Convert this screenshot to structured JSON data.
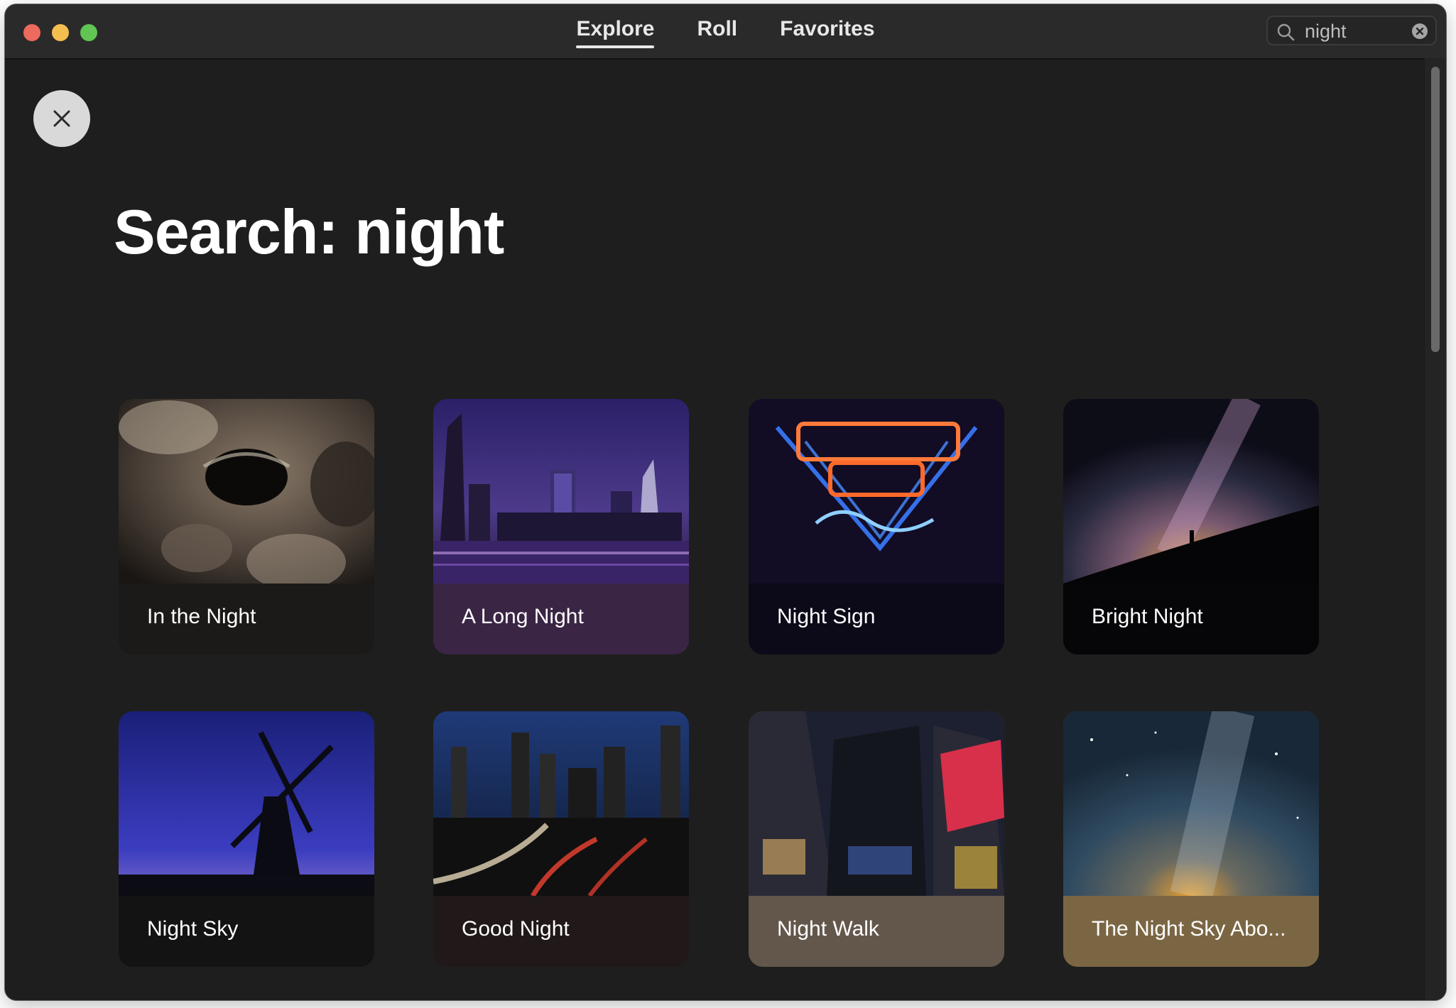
{
  "titlebar": {
    "tabs": [
      {
        "label": "Explore",
        "active": true
      },
      {
        "label": "Roll",
        "active": false
      },
      {
        "label": "Favorites",
        "active": false
      }
    ],
    "search": {
      "value": "night",
      "icon": "search-icon",
      "clear_icon": "clear-circle-icon"
    }
  },
  "main": {
    "close_icon": "close-icon",
    "title": "Search: night"
  },
  "cards": [
    {
      "title": "In the Night",
      "label_bg": "#1c1a18"
    },
    {
      "title": "A Long Night",
      "label_bg": "#3a2544"
    },
    {
      "title": "Night Sign",
      "label_bg": "#0c0a18"
    },
    {
      "title": "Bright Night",
      "label_bg": "#060608"
    },
    {
      "title": "Night Sky",
      "label_bg": "#141313"
    },
    {
      "title": "Good Night",
      "label_bg": "#201819"
    },
    {
      "title": "Night Walk",
      "label_bg": "#63574b"
    },
    {
      "title": "The Night Sky Abo...",
      "label_bg": "#7b6644"
    }
  ],
  "colors": {
    "window_bg": "#1e1e1e",
    "titlebar_bg": "#2b2a2a",
    "close_red": "#ed6a5e",
    "minimize_yellow": "#f5bf4f",
    "maximize_green": "#61c554"
  }
}
